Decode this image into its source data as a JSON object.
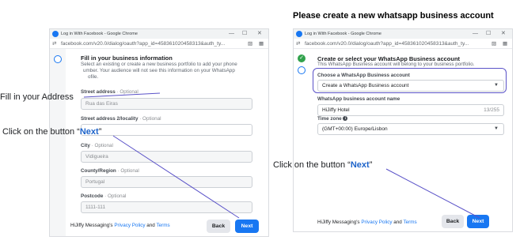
{
  "page_heading": "Please create a new whatsapp business account",
  "annotations": {
    "fill_address": "Fill in your Address",
    "click_next_left_prefix": "Click on the button “",
    "click_next_left_word": "Next",
    "click_next_left_suffix": "”",
    "click_next_right_prefix": "Click on the button “",
    "click_next_right_word": "Next",
    "click_next_right_suffix": "”"
  },
  "browser": {
    "tab_title": "Log in With Facebook - Google Chrome",
    "tab_title_right": "Log in With Facebook - Google Chrome",
    "url": "facebook.com/v20.0/dialog/oauth?app_id=458361020458313&auth_ty...",
    "url_right": "facebook.com/v20.0/dialog/oauth?app_id=458361020458313&auth_ty...",
    "minimize": "—",
    "maximize": "☐",
    "close": "✕"
  },
  "left_panel": {
    "title": "Fill in your business information",
    "desc_line1": "Select an existing or create a new business portfolio to add your phone",
    "desc_line2": "umber. Your audience will not see this information on your WhatsApp",
    "desc_line3": "ofile.",
    "fields": [
      {
        "label": "Street address",
        "optional": " · Optional",
        "value": "Rua das Eiras"
      },
      {
        "label": "Street address 2/locality",
        "optional": " · Optional",
        "value": ""
      },
      {
        "label": "City",
        "optional": " · Optional",
        "value": "Vidigueira"
      },
      {
        "label": "County/Region",
        "optional": " · Optional",
        "value": "Portugal"
      },
      {
        "label": "Postcode",
        "optional": " · Optional",
        "value": "1111-111"
      }
    ],
    "footer_prefix": "HiJiffy Messaging's ",
    "privacy_link": "Privacy Policy",
    "footer_and": " and ",
    "terms_link": "Terms",
    "back_label": "Back",
    "next_label": "Next"
  },
  "right_panel": {
    "title": "Create or select your WhatsApp Business account",
    "desc": "This WhatsApp Business account will belong to your business portfolio.",
    "choose_label": "Choose a WhatsApp Business account",
    "choose_value": "Create a WhatsApp Business account",
    "name_label": "WhatsApp business account name",
    "name_value": "HiJiffy Hotel",
    "name_count": "13/255",
    "tz_label": "Time zone",
    "tz_value": "(GMT+00:00) Europe/Lisbon",
    "footer_prefix": "HiJiffy Messaging's ",
    "privacy_link": "Privacy Policy",
    "footer_and": " and ",
    "terms_link": "Terms",
    "back_label": "Back",
    "next_label": "Next"
  },
  "colors": {
    "accent": "#1877f2",
    "success": "#31a24c",
    "annotation_line": "#5a52c8"
  }
}
